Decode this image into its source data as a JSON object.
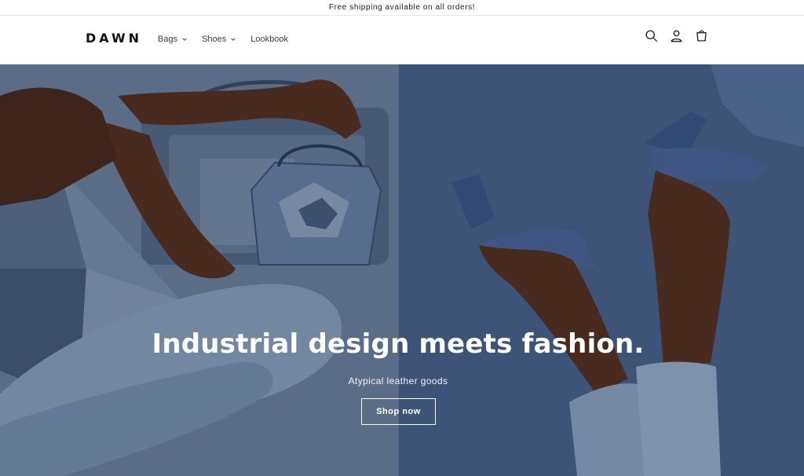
{
  "announcement": {
    "text": "Free shipping available on all orders!"
  },
  "header": {
    "logo": "DAWN",
    "nav": [
      {
        "label": "Bags",
        "has_dropdown": true
      },
      {
        "label": "Shoes",
        "has_dropdown": true
      },
      {
        "label": "Lookbook",
        "has_dropdown": false
      }
    ],
    "icons": [
      "search-icon",
      "account-icon",
      "cart-icon"
    ]
  },
  "hero": {
    "title": "Industrial design meets fashion.",
    "subtitle": "Atypical leather goods",
    "button_label": "Shop now",
    "colors": {
      "left_bg": "#7086a4",
      "right_bg": "#4b6793",
      "denim": "#8da5c4",
      "skin": "#5a3426",
      "shoe": "#4d6aa3"
    }
  }
}
